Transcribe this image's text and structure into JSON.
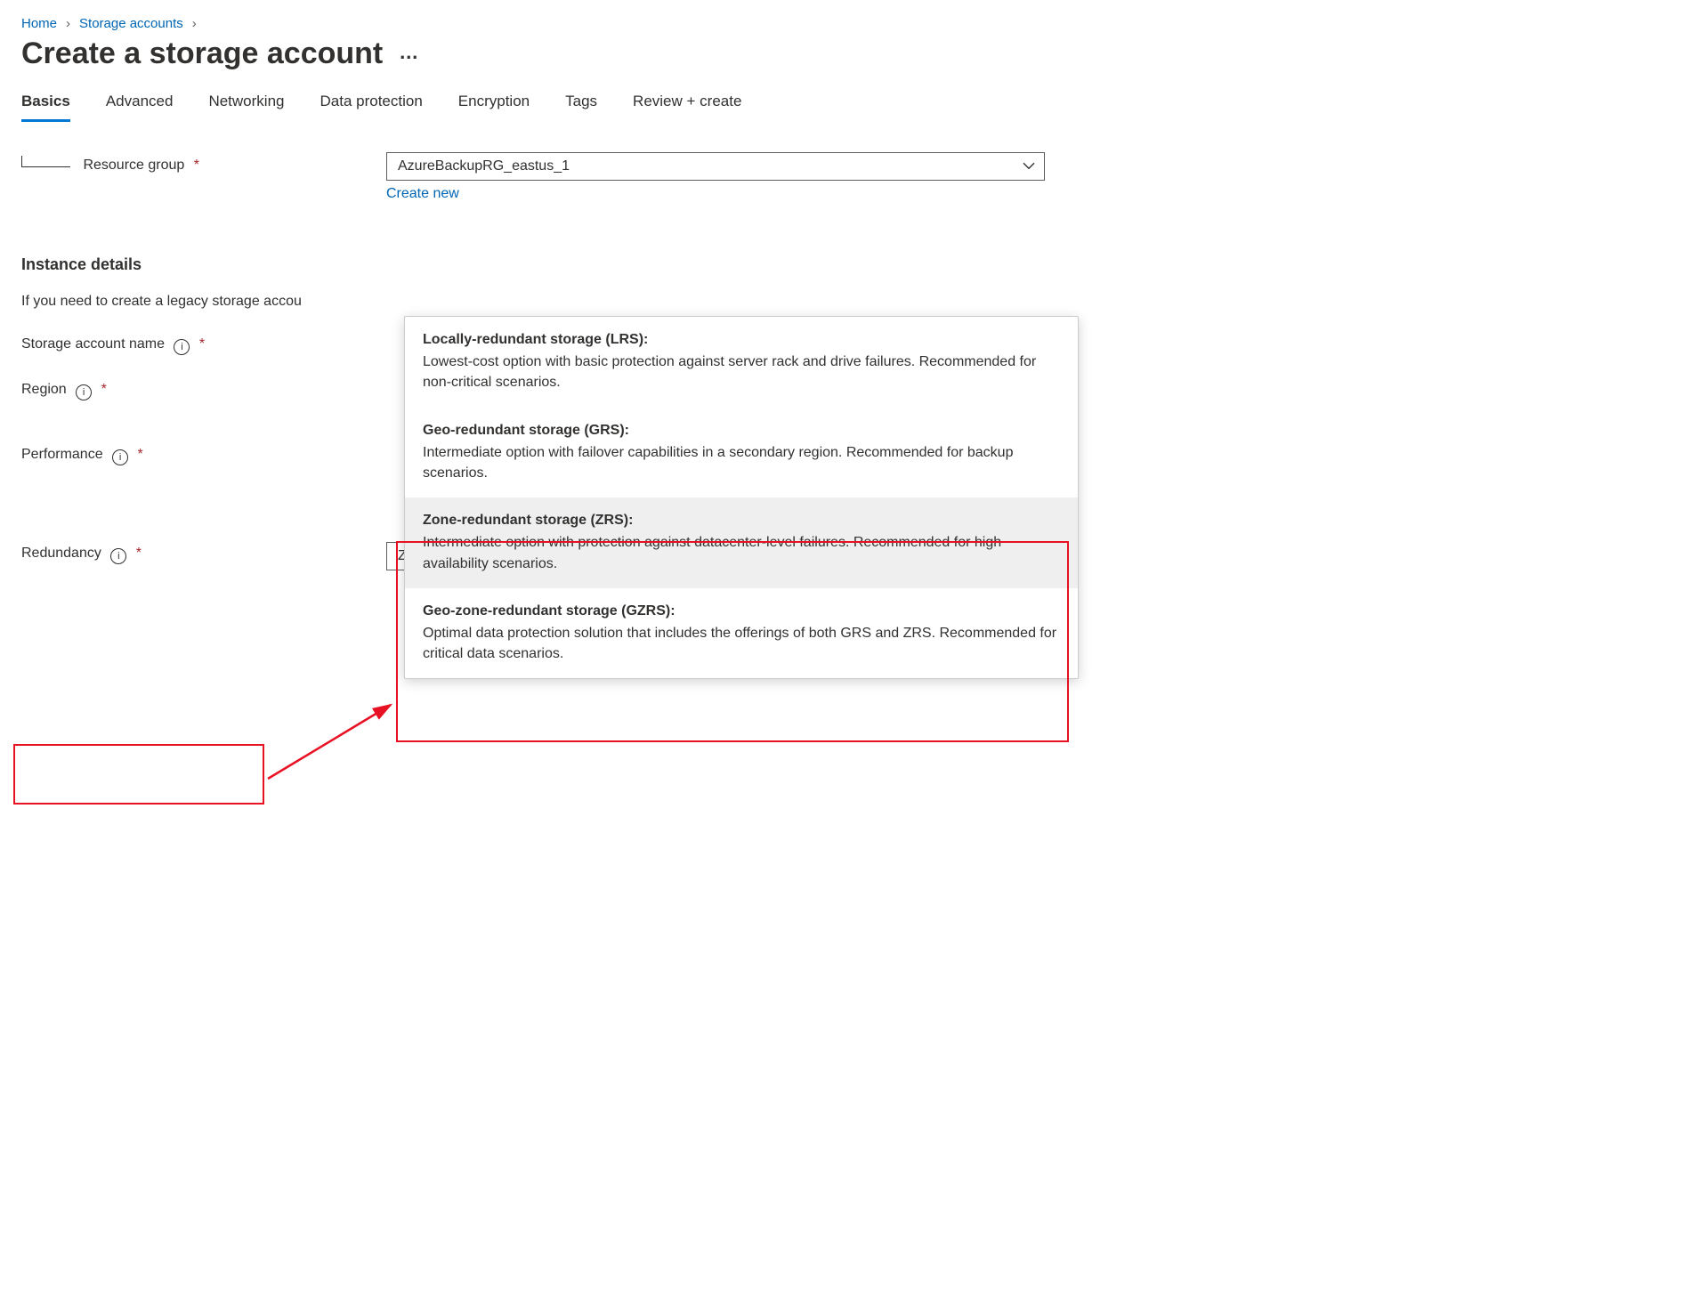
{
  "breadcrumb": {
    "home": "Home",
    "storage_accounts": "Storage accounts"
  },
  "page_title": "Create a storage account",
  "tabs": {
    "basics": "Basics",
    "advanced": "Advanced",
    "networking": "Networking",
    "data_protection": "Data protection",
    "encryption": "Encryption",
    "tags": "Tags",
    "review": "Review + create"
  },
  "labels": {
    "resource_group": "Resource group",
    "storage_account_name": "Storage account name",
    "region": "Region",
    "performance": "Performance",
    "redundancy": "Redundancy"
  },
  "resource_group": {
    "value": "AzureBackupRG_eastus_1",
    "create_new": "Create new"
  },
  "section_header": "Instance details",
  "legacy_note": "If you need to create a legacy storage accou",
  "redundancy": {
    "value": "Zone-redundant storage (ZRS)"
  },
  "options": {
    "lrs": {
      "title": "Locally-redundant storage (LRS):",
      "desc": "Lowest-cost option with basic protection against server rack and drive failures. Recommended for non-critical scenarios."
    },
    "grs": {
      "title": "Geo-redundant storage (GRS):",
      "desc": "Intermediate option with failover capabilities in a secondary region. Recommended for backup scenarios."
    },
    "zrs": {
      "title": "Zone-redundant storage (ZRS):",
      "desc": "Intermediate option with protection against datacenter-level failures. Recommended for high availability scenarios."
    },
    "gzrs": {
      "title": "Geo-zone-redundant storage (GZRS):",
      "desc": "Optimal data protection solution that includes the offerings of both GRS and ZRS. Recommended for critical data scenarios."
    }
  }
}
